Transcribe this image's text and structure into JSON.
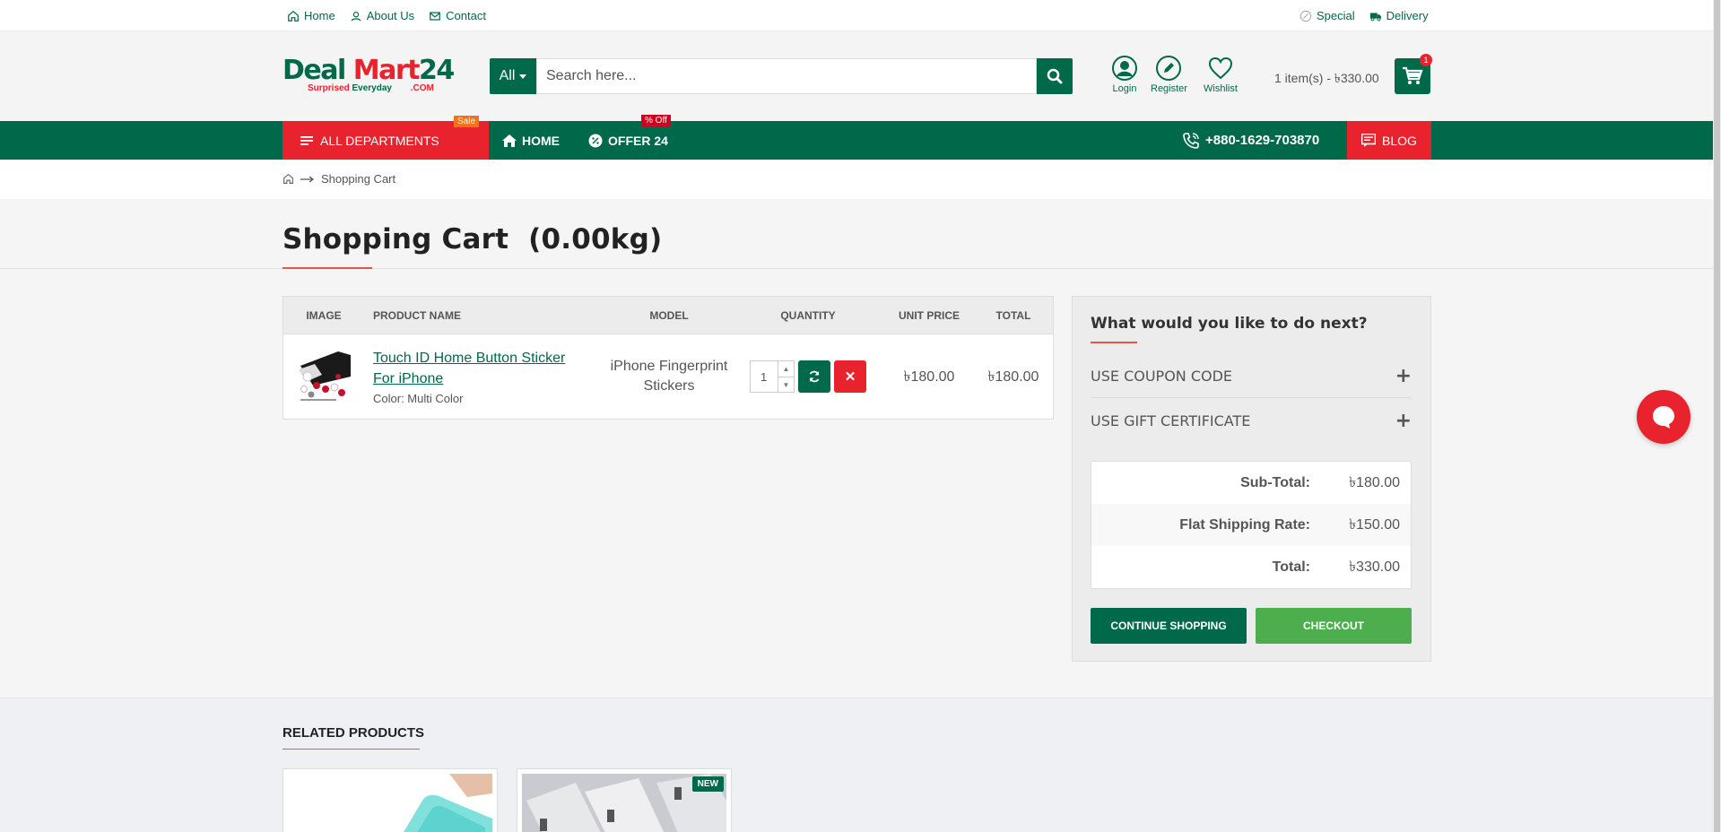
{
  "topbar": {
    "links": [
      {
        "label": "Home",
        "icon": "home-icon"
      },
      {
        "label": "About Us",
        "icon": "user-circle-icon"
      },
      {
        "label": "Contact",
        "icon": "mail-icon"
      }
    ],
    "right_links": [
      {
        "label": "Special",
        "icon": "percent-icon"
      },
      {
        "label": "Delivery",
        "icon": "truck-icon"
      }
    ]
  },
  "logo": {
    "part1": "Deal",
    "part2": "Mart",
    "part3": "24",
    "tag1": "Surprised",
    "tag2": "Everyday",
    "com": ".COM"
  },
  "search": {
    "category": "All",
    "placeholder": "Search here..."
  },
  "account": {
    "login": "Login",
    "register": "Register",
    "wishlist": "Wishlist"
  },
  "cart": {
    "summary": "1 item(s) - ৳330.00",
    "count": "1"
  },
  "nav": {
    "departments": "ALL DEPARTMENTS",
    "sale_badge": "Sale",
    "home": "HOME",
    "offer": "OFFER 24",
    "off_badge": "% Off",
    "phone": "+880-1629-703870",
    "blog": "BLOG"
  },
  "breadcrumb": {
    "current": "Shopping Cart"
  },
  "page": {
    "title": "Shopping Cart  (0.00kg)"
  },
  "table": {
    "headers": {
      "image": "IMAGE",
      "name": "PRODUCT NAME",
      "model": "MODEL",
      "quantity": "QUANTITY",
      "unit_price": "UNIT PRICE",
      "total": "TOTAL"
    },
    "rows": [
      {
        "name_line1": "Touch ID Home Button Sticker",
        "name_line2": "For iPhone",
        "option": "Color: Multi Color",
        "model_line1": "iPhone Fingerprint",
        "model_line2": "Stickers",
        "quantity": "1",
        "unit_price": "৳180.00",
        "total": "৳180.00"
      }
    ]
  },
  "panel": {
    "title": "What would you like to do next?",
    "coupon": "USE COUPON CODE",
    "gift": "USE GIFT CERTIFICATE",
    "totals": [
      {
        "label": "Sub-Total:",
        "value": "৳180.00"
      },
      {
        "label": "Flat Shipping Rate:",
        "value": "৳150.00"
      },
      {
        "label": "Total:",
        "value": "৳330.00"
      }
    ],
    "continue": "CONTINUE SHOPPING",
    "checkout": "CHECKOUT"
  },
  "related": {
    "title": "RELATED PRODUCTS",
    "new_badge": "NEW"
  },
  "colors": {
    "brand_green": "#00694a",
    "brand_red": "#e8232e",
    "checkout_green": "#4cae4c"
  }
}
